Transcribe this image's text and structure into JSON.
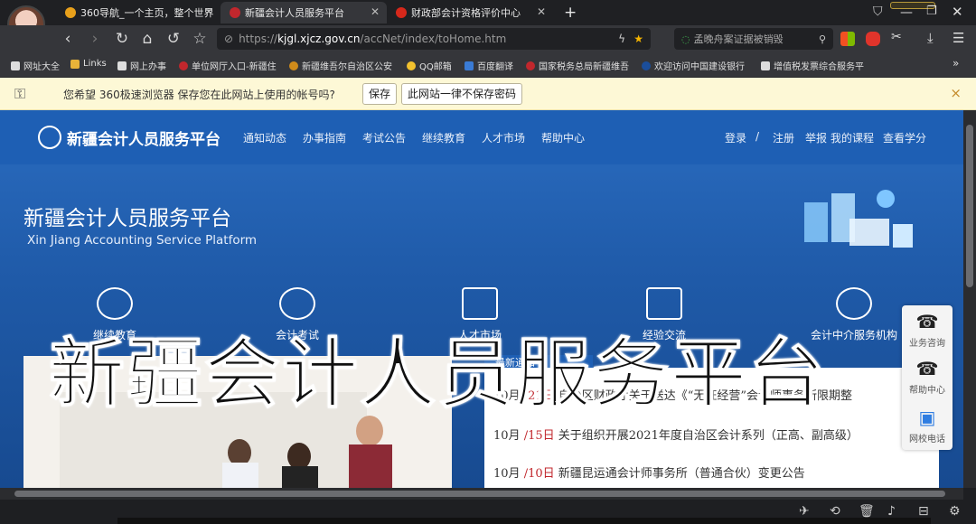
{
  "tabs": [
    {
      "label": "360导航_一个主页，整个世界",
      "fav": "#e8a01b"
    },
    {
      "label": "新疆会计人员服务平台",
      "fav": "#c1272d"
    },
    {
      "label": "财政部会计资格评价中心",
      "fav": "#d6281b"
    }
  ],
  "new_tab": "+",
  "toolbar": {
    "url_scheme": "https://",
    "url_host": "kjgl.xjcz.gov.cn",
    "url_path": "/accNet/index/toHome.htm",
    "search_placeholder": "孟晚舟案证据被销毁"
  },
  "bookmarks": [
    {
      "label": "网址大全",
      "color": "#ddd"
    },
    {
      "label": "Links",
      "color": "#e8b339"
    },
    {
      "label": "网上办事",
      "color": "#ddd"
    },
    {
      "label": "单位网厅入口-新疆住",
      "color": "#c1272d"
    },
    {
      "label": "新疆维吾尔自治区公安",
      "color": "#d08b1a"
    },
    {
      "label": "QQ邮箱",
      "color": "#f2c12e"
    },
    {
      "label": "百度翻译",
      "color": "#3a7bd5"
    },
    {
      "label": "国家税务总局新疆维吾",
      "color": "#c1272d"
    },
    {
      "label": "欢迎访问中国建设银行",
      "color": "#1b4e9b"
    },
    {
      "label": "增值税发票综合服务平",
      "color": "#ddd"
    }
  ],
  "pwbar": {
    "message": "您希望 360极速浏览器 保存您在此网站上使用的帐号吗?",
    "save_label": "保存",
    "never_label": "此网站一律不保存密码",
    "close": "×"
  },
  "site": {
    "logo_text": "新疆会计人员服务平台",
    "nav": [
      "通知动态",
      "办事指南",
      "考试公告",
      "继续教育",
      "人才市场",
      "帮助中心"
    ],
    "login": "登录",
    "sep": "/",
    "register": "注册",
    "report": "举报",
    "my_courses": "我的课程",
    "credits": "查看学分",
    "hero_title": "新疆会计人员服务平台",
    "hero_sub": "Xin Jiang Accounting Service Platform",
    "features": [
      "继续教育",
      "会计考试",
      "人才市场",
      "经验交流",
      "会计中介服务机构"
    ],
    "overlay": "新疆会计人员服务平台",
    "news": [
      {
        "month": "10月",
        "sep": "/",
        "day": "21日",
        "title": "自治区财政厅关于送达《“无证经营”会计师事务所限期整"
      },
      {
        "month": "10月",
        "sep": "/",
        "day": "15日",
        "title": "关于组织开展2021年度自治区会计系列（正高、副高级）"
      },
      {
        "month": "10月",
        "sep": "/",
        "day": "10日",
        "title": "新疆昆运通会计师事务所（普通合伙）变更公告"
      }
    ],
    "news_tab": "最新通知"
  },
  "side_widget": [
    "业务咨询",
    "帮助中心",
    "网校电话"
  ]
}
